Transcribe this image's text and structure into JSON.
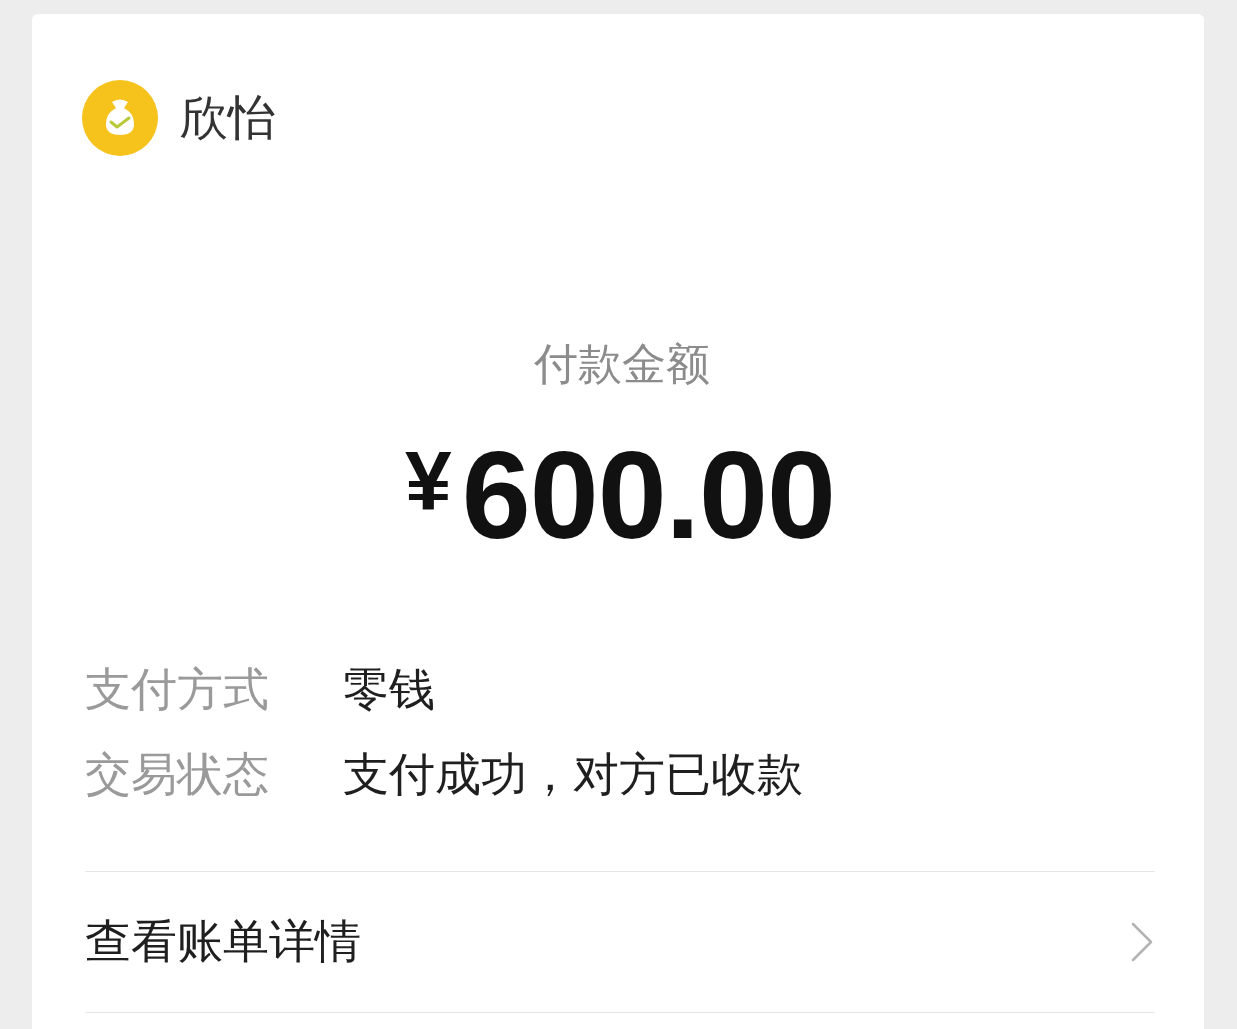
{
  "payee": {
    "name": "欣怡"
  },
  "payment": {
    "title": "付款金额",
    "currency": "¥",
    "amount": "600.00"
  },
  "details": [
    {
      "label": "支付方式",
      "value": "零钱"
    },
    {
      "label": "交易状态",
      "value": "支付成功，对方已收款"
    }
  ],
  "bill_link": {
    "label": "查看账单详情"
  }
}
